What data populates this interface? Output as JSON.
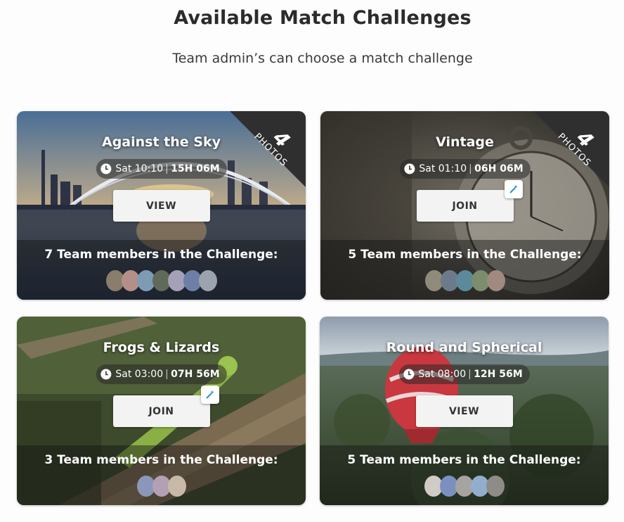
{
  "page": {
    "title": "Available Match Challenges",
    "subtitle": "Team admin’s can choose a match challenge"
  },
  "cards": [
    {
      "title": "Against the Sky",
      "time": "Sat 10:10",
      "time_left": "15H 06M",
      "button": "VIEW",
      "members": "7 Team members in the Challenge:",
      "photos_count": "4",
      "photos_label": "PHOTOS",
      "avatar_count": 7,
      "has_magic_icon": false
    },
    {
      "title": "Vintage",
      "time": "Sat 01:10",
      "time_left": "06H 06M",
      "button": "JOIN",
      "members": "5 Team members in the Challenge:",
      "photos_count": "4",
      "photos_label": "PHOTOS",
      "avatar_count": 5,
      "has_magic_icon": true
    },
    {
      "title": "Frogs & Lizards",
      "time": "Sat 03:00",
      "time_left": "07H 56M",
      "button": "JOIN",
      "members": "3 Team members in the Challenge:",
      "avatar_count": 3,
      "has_magic_icon": true
    },
    {
      "title": "Round and Spherical",
      "time": "Sat 08:00",
      "time_left": "12H 56M",
      "button": "VIEW",
      "members": "5 Team members in the Challenge:",
      "avatar_count": 5,
      "has_magic_icon": false
    }
  ],
  "icons": {
    "clock": "clock-icon",
    "magic": "magic-wand-icon"
  }
}
